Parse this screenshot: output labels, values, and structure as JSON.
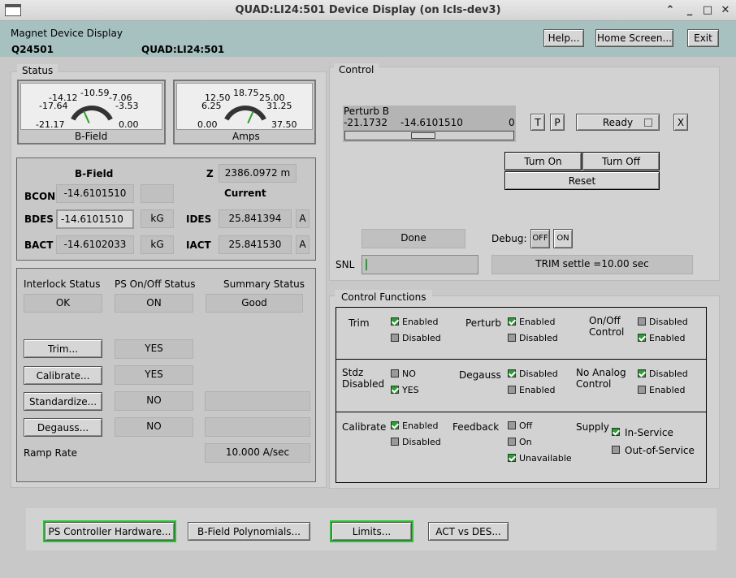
{
  "window": {
    "title": "QUAD:LI24:501 Device Display (on lcls-dev3)"
  },
  "header": {
    "display_name": "Magnet Device Display",
    "device_short": "Q24501",
    "device_pv": "QUAD:LI24:501",
    "help_label": "Help...",
    "home_label": "Home Screen...",
    "exit_label": "Exit"
  },
  "status": {
    "tab": "Status",
    "bfield_meter": {
      "label": "B-Field",
      "ticks": [
        "-21.17",
        "-17.64",
        "-14.12",
        "-10.59",
        "-7.06",
        "-3.53",
        "0.00"
      ],
      "value": -14.61
    },
    "amps_meter": {
      "label": "Amps",
      "ticks": [
        "0.00",
        "6.25",
        "12.50",
        "18.75",
        "25.00",
        "31.25",
        "37.50"
      ],
      "value": 25.84
    },
    "bfield_header": "B-Field",
    "z_label": "Z",
    "z_value": "2386.0972 m",
    "current_header": "Current",
    "bcon_label": "BCON",
    "bcon_value": "-14.6101510",
    "bdes_label": "BDES",
    "bdes_value": "-14.6101510",
    "bdes_unit": "kG",
    "bact_label": "BACT",
    "bact_value": "-14.6102033",
    "bact_unit": "kG",
    "ides_label": "IDES",
    "ides_value": "25.841394",
    "ides_unit": "A",
    "iact_label": "IACT",
    "iact_value": "25.841530",
    "iact_unit": "A",
    "interlock_label": "Interlock Status",
    "interlock_value": "OK",
    "ps_onoff_label": "PS On/Off Status",
    "ps_onoff_value": "ON",
    "summary_label": "Summary Status",
    "summary_value": "Good",
    "trim_button": "Trim...",
    "trim_value": "YES",
    "calibrate_button": "Calibrate...",
    "calibrate_value": "YES",
    "standardize_button": "Standardize...",
    "standardize_value": "NO",
    "degauss_button": "Degauss...",
    "degauss_value": "NO",
    "ramp_label": "Ramp Rate",
    "ramp_value": "10.000 A/sec"
  },
  "control": {
    "tab": "Control",
    "perturb_label": "Perturb B",
    "slider_min": "-21.1732",
    "slider_value": "-14.6101510",
    "slider_max": "0",
    "slider_fraction": 0.31,
    "t_button": "T",
    "p_button": "P",
    "ready_label": "Ready",
    "x_button": "X",
    "turn_on": "Turn On",
    "turn_off": "Turn Off",
    "reset": "Reset",
    "done_label": "Done",
    "debug_label": "Debug:",
    "debug_off": "OFF",
    "debug_on": "ON",
    "snl_label": "SNL",
    "trim_settle": "TRIM settle =10.00 sec"
  },
  "functions": {
    "tab": "Control Functions",
    "trim_label": "Trim",
    "trim_enabled": "Enabled",
    "trim_disabled": "Disabled",
    "perturb_label": "Perturb",
    "perturb_enabled": "Enabled",
    "perturb_disabled": "Disabled",
    "onoff_label1": "On/Off",
    "onoff_label2": "Control",
    "onoff_disabled": "Disabled",
    "onoff_enabled": "Enabled",
    "stdz_label1": "Stdz",
    "stdz_label2": "Disabled",
    "stdz_no": "NO",
    "stdz_yes": "YES",
    "degauss_label": "Degauss",
    "degauss_disabled": "Disabled",
    "degauss_enabled": "Enabled",
    "noanalog_label1": "No Analog",
    "noanalog_label2": "Control",
    "noanalog_disabled": "Disabled",
    "noanalog_enabled": "Enabled",
    "calibrate_label": "Calibrate",
    "calibrate_enabled": "Enabled",
    "calibrate_disabled": "Disabled",
    "feedback_label": "Feedback",
    "feedback_off": "Off",
    "feedback_on": "On",
    "feedback_unavailable": "Unavailable",
    "supply_label": "Supply",
    "supply_in": "In-Service",
    "supply_out": "Out-of-Service"
  },
  "footer": {
    "ps_hw": "PS Controller Hardware...",
    "bfield_poly": "B-Field Polynomials...",
    "limits": "Limits...",
    "act_des": "ACT vs DES..."
  },
  "colors": {
    "header_bg": "#a7c0c0",
    "green_outline": "#26c630",
    "gauge_needle": "#2aa02a"
  }
}
